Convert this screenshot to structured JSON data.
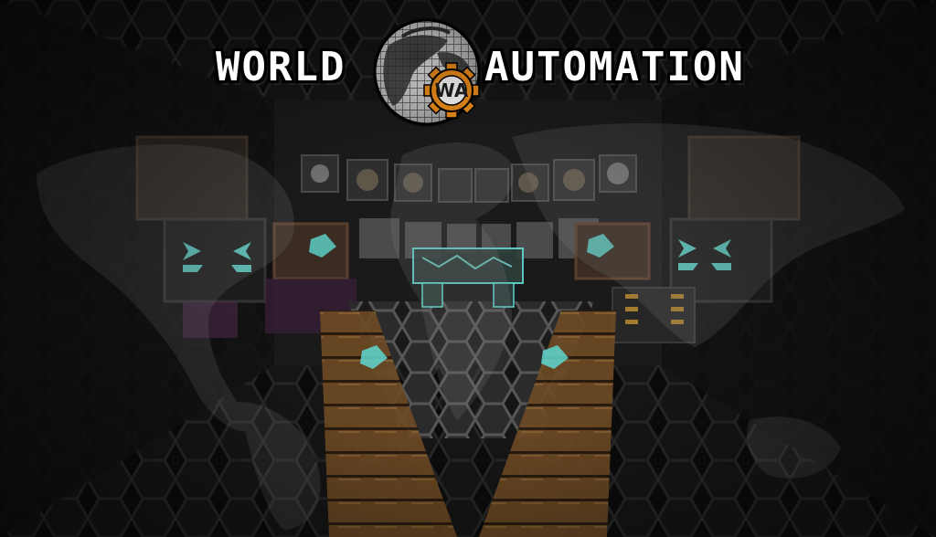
{
  "title": {
    "left_word": "WORLD",
    "right_word": "AUTOMATION",
    "badge": "WA"
  },
  "scene": {
    "description_icons": [
      "world-globe-icon",
      "gear-icon",
      "diamond-ore-icon",
      "arrow-marker-icon"
    ]
  },
  "colors": {
    "background": "#0b0b0b",
    "badge_orange": "#e88a1a",
    "diamond_cyan": "#5fd8d0",
    "wood": "#8a5a2a",
    "title_white": "#ffffff"
  }
}
